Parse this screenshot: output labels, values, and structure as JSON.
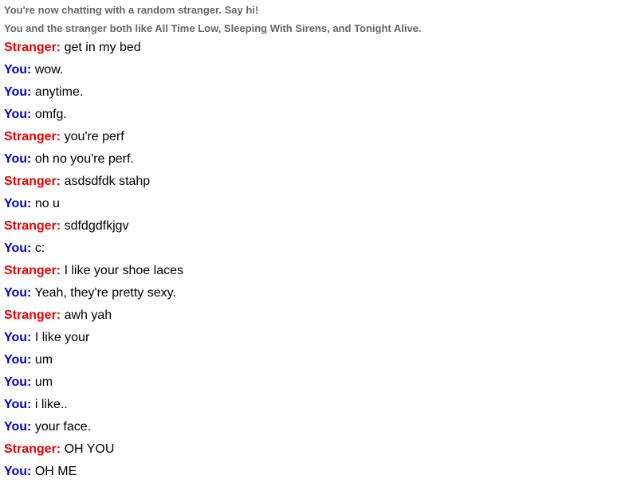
{
  "status": {
    "connected": "You're now chatting with a random stranger. Say hi!",
    "common_likes": "You and the stranger both like All Time Low, Sleeping With Sirens, and Tonight Alive."
  },
  "colors": {
    "stranger": "#ee0000",
    "you": "#0000cc",
    "status_text": "#666666",
    "message_text": "#000000",
    "background": "#ffffff"
  },
  "messages": [
    {
      "speaker": "Stranger:",
      "role": "stranger",
      "text": "get in my bed"
    },
    {
      "speaker": "You:",
      "role": "you",
      "text": "wow."
    },
    {
      "speaker": "You:",
      "role": "you",
      "text": "anytime."
    },
    {
      "speaker": "You:",
      "role": "you",
      "text": "omfg."
    },
    {
      "speaker": "Stranger:",
      "role": "stranger",
      "text": "you're perf"
    },
    {
      "speaker": "You:",
      "role": "you",
      "text": "oh no you're perf."
    },
    {
      "speaker": "Stranger:",
      "role": "stranger",
      "text": "asdsdfdk stahp"
    },
    {
      "speaker": "You:",
      "role": "you",
      "text": "no u"
    },
    {
      "speaker": "Stranger:",
      "role": "stranger",
      "text": "sdfdgdfkjgv"
    },
    {
      "speaker": "You:",
      "role": "you",
      "text": "c:"
    },
    {
      "speaker": "Stranger:",
      "role": "stranger",
      "text": "I like your shoe laces"
    },
    {
      "speaker": "You:",
      "role": "you",
      "text": "Yeah, they're pretty sexy."
    },
    {
      "speaker": "Stranger:",
      "role": "stranger",
      "text": "awh yah"
    },
    {
      "speaker": "You:",
      "role": "you",
      "text": "I like your"
    },
    {
      "speaker": "You:",
      "role": "you",
      "text": "um"
    },
    {
      "speaker": "You:",
      "role": "you",
      "text": "um"
    },
    {
      "speaker": "You:",
      "role": "you",
      "text": "i like.."
    },
    {
      "speaker": "You:",
      "role": "you",
      "text": "your face."
    },
    {
      "speaker": "Stranger:",
      "role": "stranger",
      "text": "OH YOU"
    },
    {
      "speaker": "You:",
      "role": "you",
      "text": "OH ME"
    }
  ]
}
